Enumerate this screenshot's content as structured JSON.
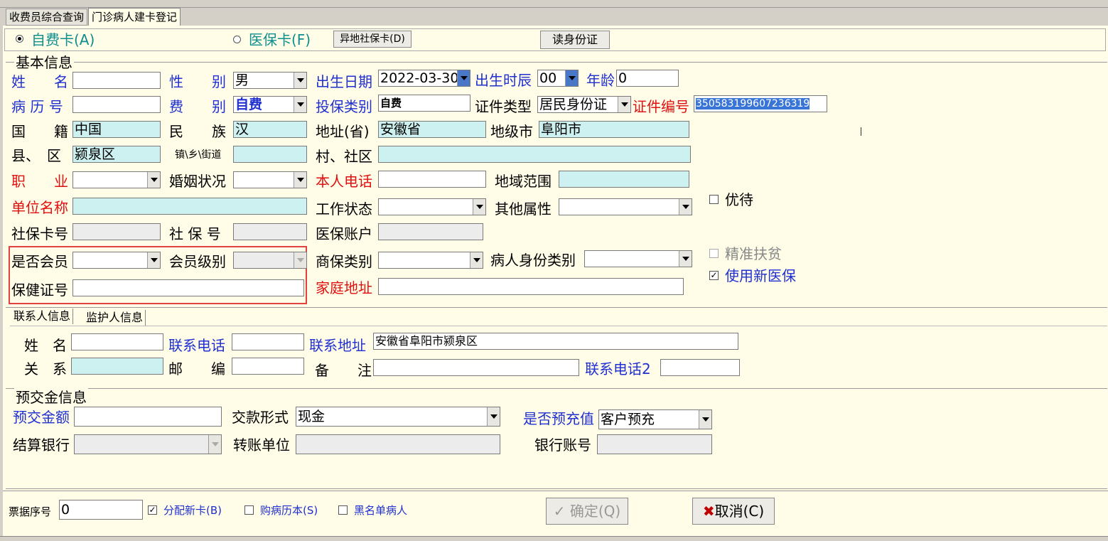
{
  "top_tabs": [
    "收费员综合查询",
    "门诊病人建卡登记"
  ],
  "card_type": {
    "self_pay": "自费卡(A)",
    "medical": "医保卡(F)",
    "remote_btn": "异地社保卡(D)",
    "read_id_btn": "读身份证"
  },
  "basic": {
    "legend": "基本信息",
    "name_label": "姓　　名",
    "gender_label": "性　　别",
    "gender_value": "男",
    "birth_label": "出生日期",
    "birth_value": "2022-03-30",
    "birth_hour_label": "出生时辰",
    "birth_hour_value": "00",
    "age_label": "年龄",
    "age_value": "0",
    "record_no_label": "病 历 号",
    "fee_label": "费　　别",
    "fee_value": "自费",
    "insure_type_label": "投保类别",
    "insure_type_value": "自费",
    "id_type_label": "证件类型",
    "id_type_value": "居民身份证",
    "id_no_label": "证件编号",
    "id_no_value": "350583199607236319",
    "nation_label": "国　　籍",
    "nation_value": "中国",
    "ethnic_label": "民　　族",
    "ethnic_value": "汉",
    "province_label": "地址(省)",
    "province_value": "安徽省",
    "city_label": "地级市",
    "city_value": "阜阳市",
    "county_label": "县、　区",
    "county_value": "颍泉区",
    "town_label": "镇\\乡\\街道",
    "village_label": "村、社区",
    "job_label": "职　　业",
    "marital_label": "婚姻状况",
    "phone_label": "本人电话",
    "region_label": "地域范围",
    "preferential_label": "优待",
    "company_label": "单位名称",
    "work_status_label": "工作状态",
    "other_attr_label": "其他属性",
    "social_card_label": "社保卡号",
    "social_no_label": "社 保 号",
    "medical_account_label": "医保账户",
    "member_label": "是否会员",
    "member_level_label": "会员级别",
    "commercial_label": "商保类别",
    "patient_type_label": "病人身份类别",
    "poverty_label": "精准扶贫",
    "new_insurance_label": "使用新医保",
    "health_cert_label": "保健证号",
    "home_addr_label": "家庭地址"
  },
  "contact_tabs": [
    "联系人信息",
    "监护人信息"
  ],
  "contact": {
    "name_label": "姓　名",
    "phone_label": "联系电话",
    "addr_label": "联系地址",
    "addr_value": "安徽省阜阳市颍泉区",
    "relation_label": "关　系",
    "postcode_label": "邮　　编",
    "remark_label": "备　　注",
    "phone2_label": "联系电话2"
  },
  "prepay": {
    "legend": "预交金信息",
    "amount_label": "预交金额",
    "pay_form_label": "交款形式",
    "pay_form_value": "现金",
    "precharge_label": "是否预充值",
    "precharge_value": "客户预充",
    "bank_label": "结算银行",
    "transfer_label": "转账单位",
    "account_label": "银行账号"
  },
  "bottom": {
    "receipt_label": "票据序号",
    "receipt_value": "0",
    "new_card_label": "分配新卡(B)",
    "buy_record_label": "购病历本(S)",
    "blacklist_label": "黑名单病人",
    "confirm_btn": "确定(Q)",
    "cancel_btn": "取消(C)"
  }
}
